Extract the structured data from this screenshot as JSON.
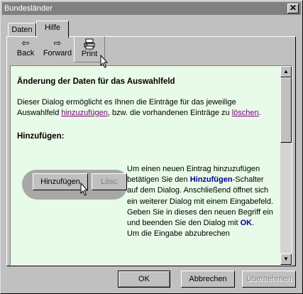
{
  "window": {
    "title": "Bundesländer",
    "close_glyph": "✕"
  },
  "tabs": [
    {
      "label": "Daten"
    },
    {
      "label": "Hilfe"
    }
  ],
  "toolbar": {
    "back": {
      "label": "Back",
      "icon": "arrow-left-icon"
    },
    "forward": {
      "label": "Forward",
      "icon": "arrow-right-icon"
    },
    "print": {
      "label": "Print",
      "icon": "printer-icon"
    }
  },
  "help": {
    "heading": "Änderung der Daten für das Auswahlfeld",
    "intro_1": "Dieser Dialog ermöglicht es Ihnen die Einträge für das jeweilige Auswahlfeld ",
    "link_add": "hinzuzufügen",
    "intro_2": ", bzw. die vorhandenen Einträge zu ",
    "link_delete": "löschen",
    "intro_3": ".",
    "subheading": "Hinzufügen:",
    "illus_btn_add": "Hinzufügen",
    "illus_btn_del": "Lösc",
    "body_1": "Um einen neuen Eintrag hinzuzufügen betätigen Sie den ",
    "body_bold_1": "Hinzufügen",
    "body_2": "-Schalter auf dem Dialog. Anschließend öffnet sich ein weiterer Dialog mit einem Eingabefeld. Geben Sie in dieses den neuen Begriff ein und beenden Sie den Dialog mit ",
    "body_bold_2": "OK",
    "body_3": ".",
    "body_4": "Um die Eingabe abzubrechen"
  },
  "buttons": {
    "ok": "OK",
    "cancel": "Abbrechen",
    "apply": "Übernehmen"
  }
}
